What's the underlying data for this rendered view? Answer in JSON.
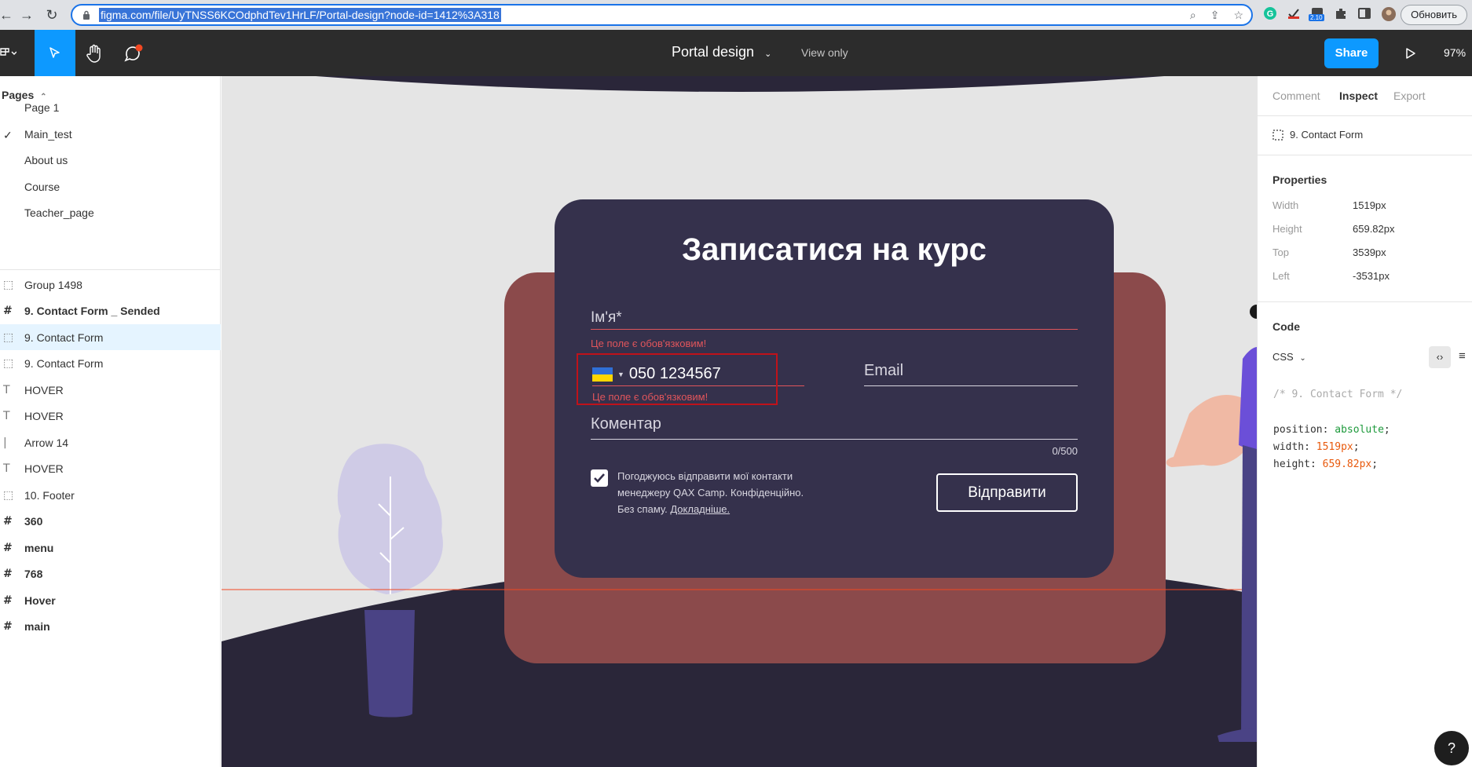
{
  "browser": {
    "url": "figma.com/file/UyTNSS6KCOdphdTev1HrLF/Portal-design?node-id=1412%3A318",
    "update_label": "Обновить",
    "ext_badge": "2.10"
  },
  "toolbar": {
    "doc_title": "Portal design",
    "view_only": "View only",
    "share_label": "Share",
    "zoom": "97%"
  },
  "left_panel": {
    "pages_header": "Pages",
    "pages": [
      {
        "label": "Page 1",
        "current": false
      },
      {
        "label": "Main_test",
        "current": true
      },
      {
        "label": "About us",
        "current": false
      },
      {
        "label": "Course",
        "current": false
      },
      {
        "label": "Teacher_page",
        "current": false
      }
    ],
    "layers": [
      {
        "label": "Group 1498",
        "icon": "group-icon",
        "bold": false,
        "selected": false
      },
      {
        "label": "9. Contact Form _ Sended",
        "icon": "frame-icon",
        "bold": true,
        "selected": false
      },
      {
        "label": "9. Contact Form",
        "icon": "group-icon",
        "bold": false,
        "selected": true
      },
      {
        "label": "9. Contact Form",
        "icon": "group-icon",
        "bold": false,
        "selected": false
      },
      {
        "label": "HOVER",
        "icon": "text-icon",
        "bold": false,
        "selected": false
      },
      {
        "label": "HOVER",
        "icon": "text-icon",
        "bold": false,
        "selected": false
      },
      {
        "label": "Arrow 14",
        "icon": "line-icon",
        "bold": false,
        "selected": false
      },
      {
        "label": "HOVER",
        "icon": "text-icon",
        "bold": false,
        "selected": false
      },
      {
        "label": "10. Footer",
        "icon": "group-icon",
        "bold": false,
        "selected": false
      },
      {
        "label": "360",
        "icon": "frame-icon",
        "bold": true,
        "selected": false
      },
      {
        "label": "menu",
        "icon": "frame-icon",
        "bold": true,
        "selected": false
      },
      {
        "label": "768",
        "icon": "frame-icon",
        "bold": true,
        "selected": false
      },
      {
        "label": "Hover",
        "icon": "frame-icon",
        "bold": true,
        "selected": false
      },
      {
        "label": "main",
        "icon": "frame-icon",
        "bold": true,
        "selected": false
      }
    ]
  },
  "form": {
    "title": "Записатися на курс",
    "name_label": "Ім'я*",
    "required_error": "Це поле є обов'язковим!",
    "phone_value": "050 1234567",
    "email_label": "Email",
    "comment_label": "Коментар",
    "comment_counter": "0/500",
    "consent_text_1": "Погоджуюсь відправити мої контакти",
    "consent_text_2": "менеджеру QAX Camp. Конфіденційно.",
    "consent_text_3": "Без спаму.",
    "consent_link": "Докладніше.",
    "submit_label": "Відправити",
    "consent_checked": true
  },
  "right_panel": {
    "tabs": [
      "Comment",
      "Inspect",
      "Export"
    ],
    "active_tab": "Inspect",
    "selection_name": "9. Contact Form",
    "properties_header": "Properties",
    "properties": [
      {
        "label": "Width",
        "value": "1519px"
      },
      {
        "label": "Height",
        "value": "659.82px"
      },
      {
        "label": "Top",
        "value": "3539px"
      },
      {
        "label": "Left",
        "value": "-3531px"
      }
    ],
    "code_header": "Code",
    "code_lang": "CSS",
    "code_comment": "/* 9. Contact Form */",
    "code_lines": [
      {
        "prop": "position",
        "value": "absolute"
      },
      {
        "prop": "width",
        "value": "1519px"
      },
      {
        "prop": "height",
        "value": "659.82px"
      }
    ]
  },
  "colors": {
    "figma_blue": "#0d99ff",
    "form_bg": "#35314c",
    "sofa": "#8b4a4b",
    "floor": "#2a2639",
    "error": "#e0555b",
    "highlight_red": "#c0121a"
  }
}
